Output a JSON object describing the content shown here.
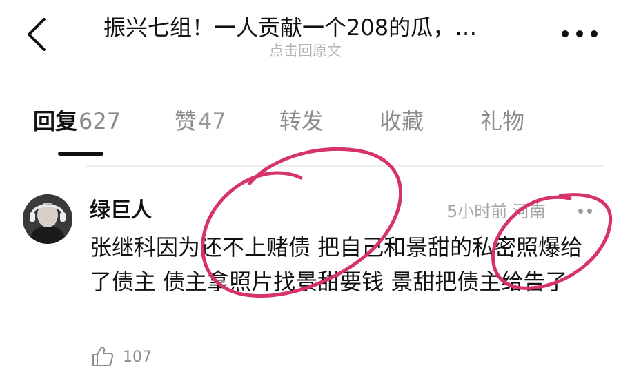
{
  "header": {
    "title": "振兴七组！一人贡献一个208的瓜，…",
    "subtitle": "点击回原文"
  },
  "tabs": [
    {
      "label": "回复",
      "count": "627",
      "active": true
    },
    {
      "label": "赞",
      "count": "47",
      "active": false
    },
    {
      "label": "转发",
      "count": "",
      "active": false
    },
    {
      "label": "收藏",
      "count": "",
      "active": false
    },
    {
      "label": "礼物",
      "count": "",
      "active": false
    }
  ],
  "comment": {
    "username": "绿巨人",
    "time": "5小时前",
    "location": "河南",
    "text": "张继科因为还不上赌债 把自己和景甜的私密照爆给了债主 债主拿照片找景甜要钱 景甜把债主给告了",
    "likes": "107"
  },
  "colors": {
    "annotation": "#d6336c",
    "text_primary": "#111111",
    "text_secondary": "#8c8c8c"
  },
  "icons": {
    "back": "chevron-left-icon",
    "more": "more-horizontal-icon",
    "like": "thumbs-up-icon"
  }
}
